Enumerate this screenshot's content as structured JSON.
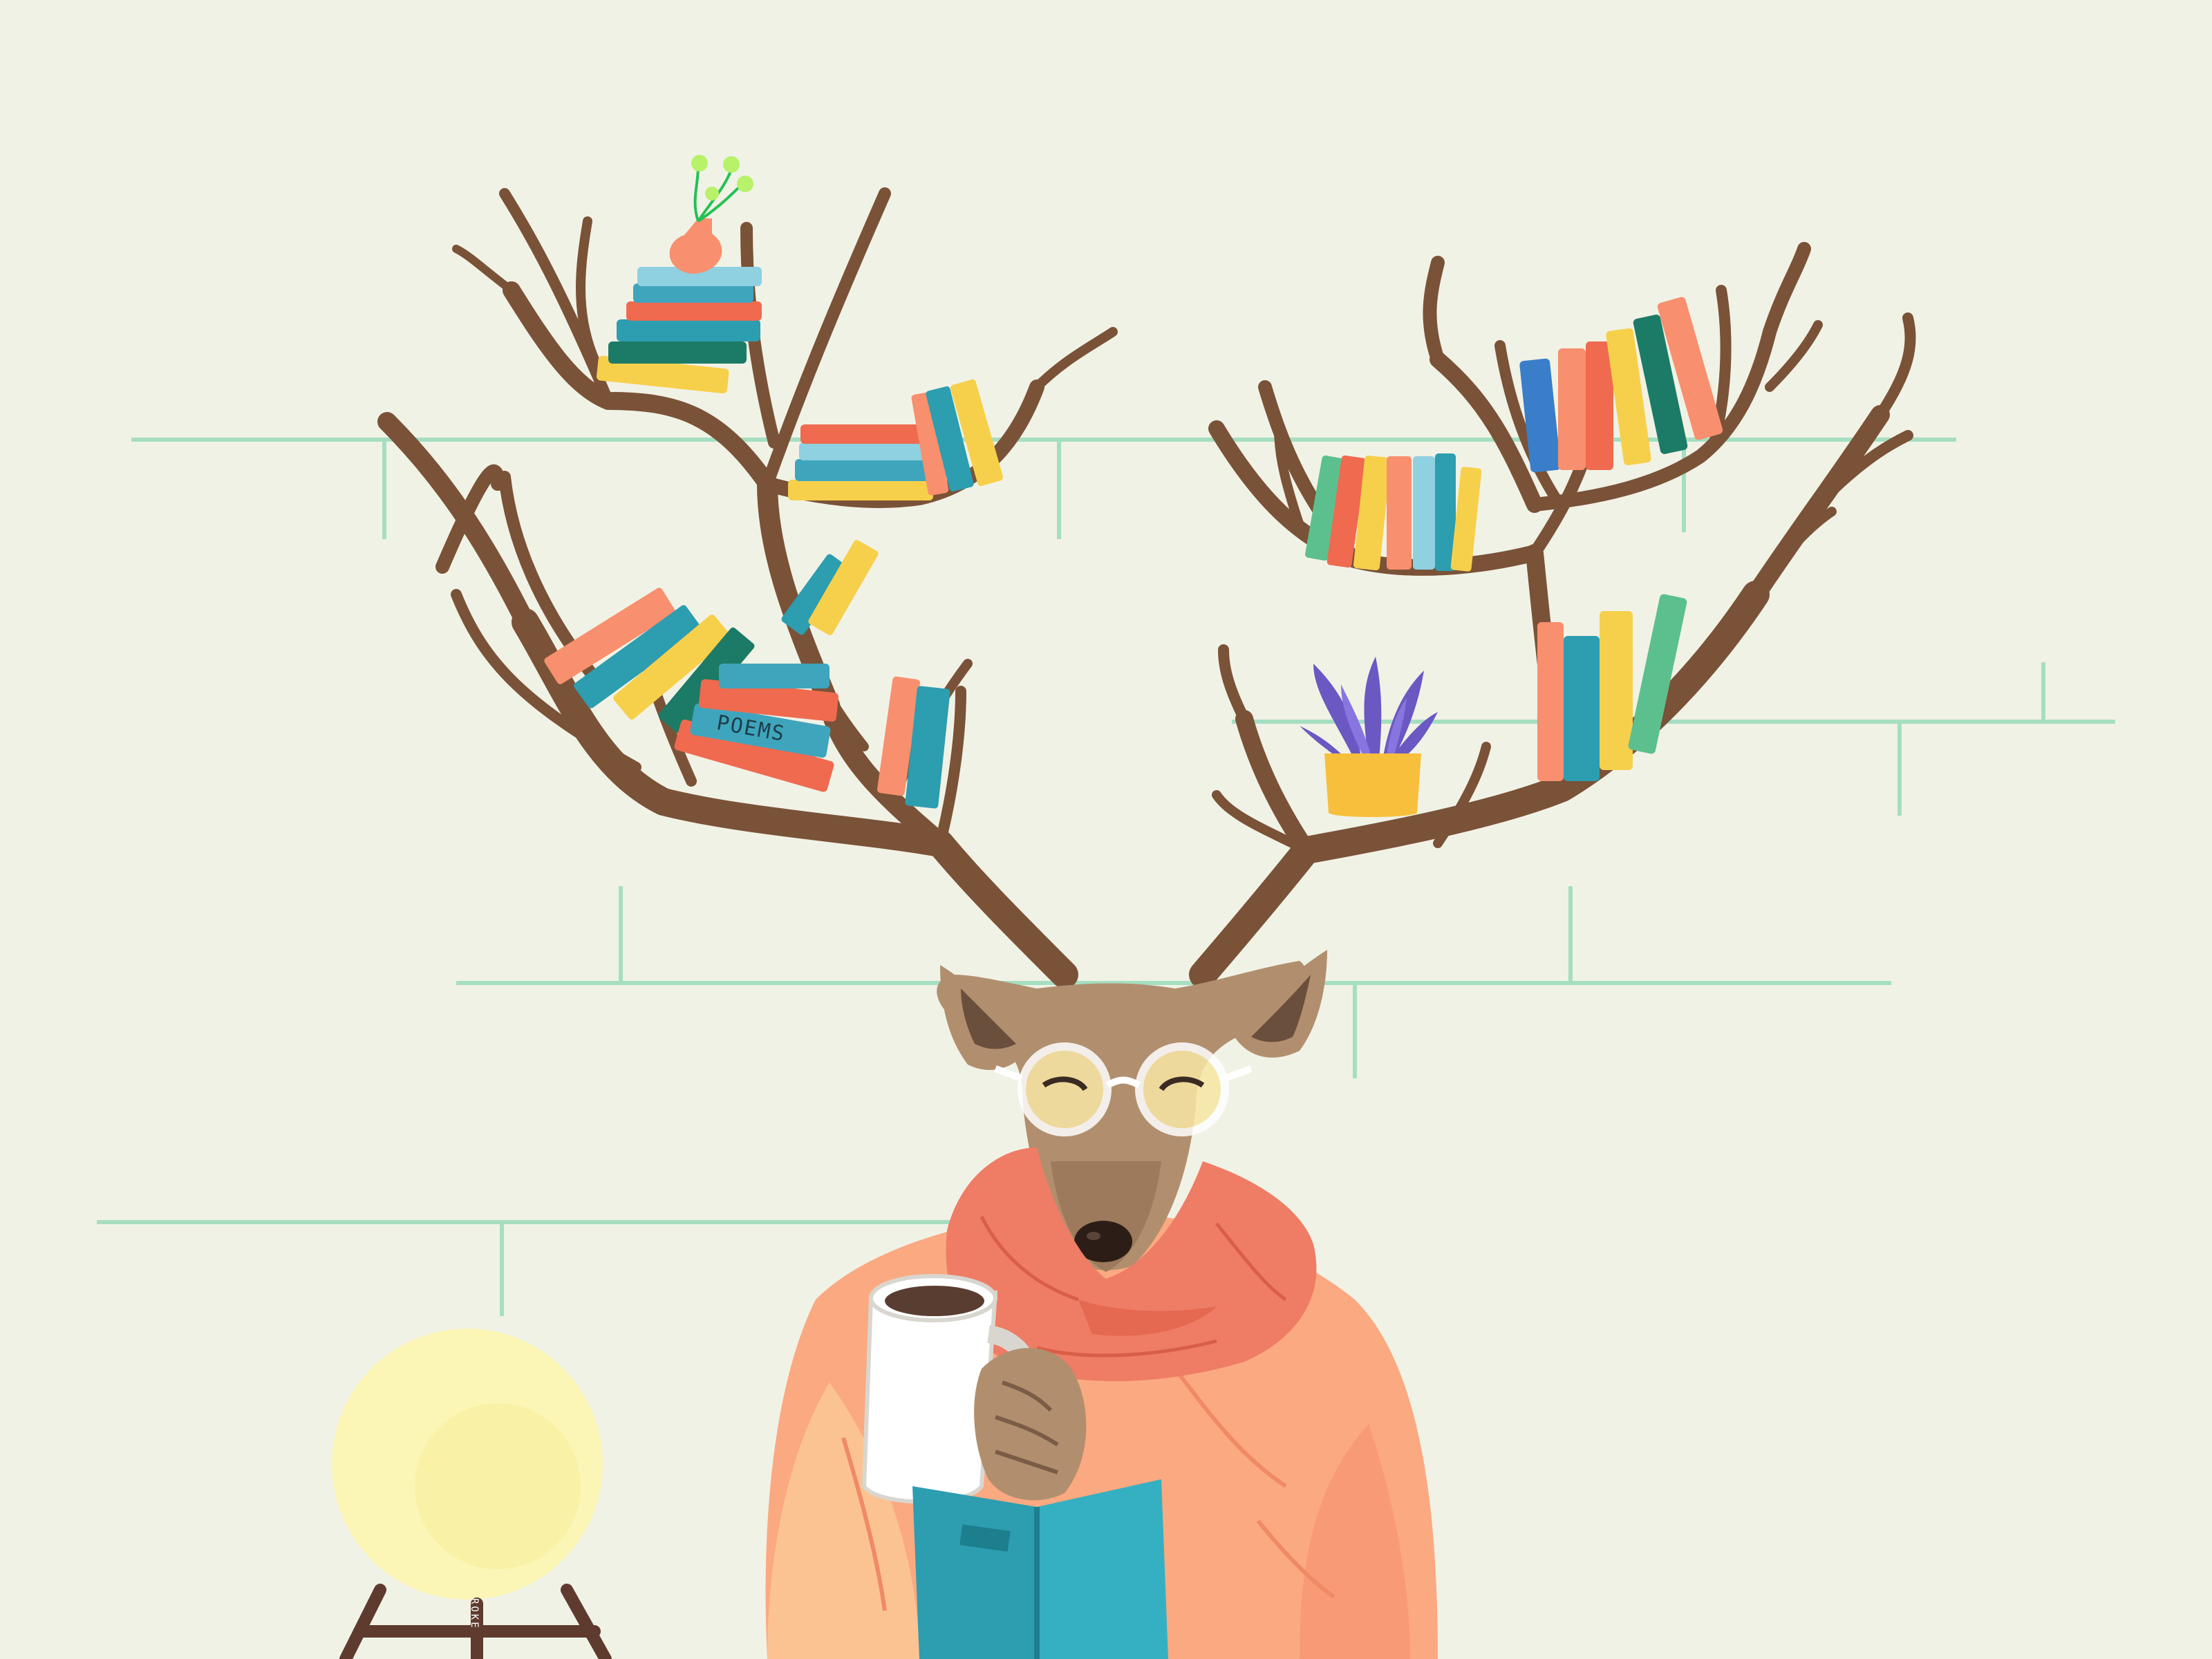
{
  "illustration": {
    "book_spine_text": "POEMS",
    "lamp_mark": "ROKE"
  },
  "palette": {
    "background": "#f1f2e6",
    "brick_lines": "#a6dec1",
    "antler": "#7a5238",
    "deer_fur": "#b18f6e",
    "scarf": "#ef7c64",
    "sweater": "#fba981",
    "book_teal": "#2d9db0",
    "lamp_glow": "#fcf6b6"
  },
  "icons": [
    "deer-icon",
    "antler-bookshelf-icon",
    "book-icon",
    "mug-icon",
    "lamp-icon",
    "plant-icon",
    "vase-icon"
  ]
}
